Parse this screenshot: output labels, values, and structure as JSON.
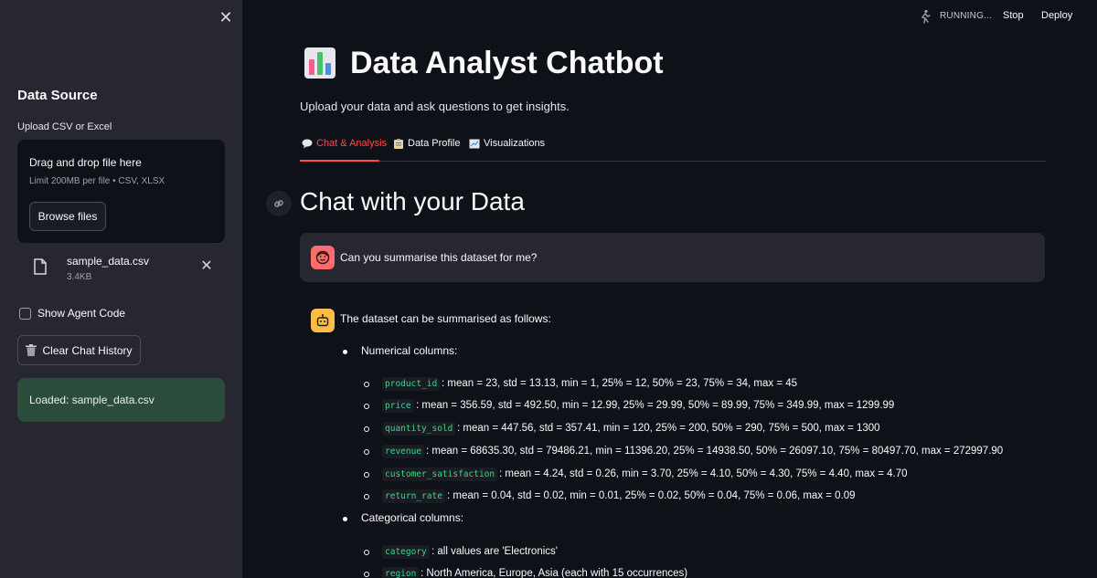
{
  "sidebar": {
    "title": "Data Source",
    "upload_label": "Upload CSV or Excel",
    "dropzone_title": "Drag and drop file here",
    "dropzone_limit": "Limit 200MB per file • CSV, XLSX",
    "browse_label": "Browse files",
    "file": {
      "name": "sample_data.csv",
      "size": "3.4KB"
    },
    "show_code_label": "Show Agent Code",
    "clear_label": "Clear Chat History",
    "loaded_text": "Loaded: sample_data.csv"
  },
  "topbar": {
    "status": "RUNNING...",
    "stop": "Stop",
    "deploy": "Deploy"
  },
  "main": {
    "title": "Data Analyst Chatbot",
    "subtitle": "Upload your data and ask questions to get insights.",
    "tabs": [
      {
        "label": "Chat & Analysis",
        "icon": "speech-bubble-icon"
      },
      {
        "label": "Data Profile",
        "icon": "clipboard-icon"
      },
      {
        "label": "Visualizations",
        "icon": "chart-icon"
      }
    ],
    "chat_title": "Chat with your Data"
  },
  "chat": {
    "user_message": "Can you summarise this dataset for me?",
    "bot_intro": "The dataset can be summarised as follows:",
    "numerical_heading": "Numerical columns:",
    "numerical": [
      {
        "col": "product_id",
        "stats": ": mean = 23, std = 13.13, min = 1, 25% = 12, 50% = 23, 75% = 34, max = 45"
      },
      {
        "col": "price",
        "stats": ": mean = 356.59, std = 492.50, min = 12.99, 25% = 29.99, 50% = 89.99, 75% = 349.99, max = 1299.99"
      },
      {
        "col": "quantity_sold",
        "stats": ": mean = 447.56, std = 357.41, min = 120, 25% = 200, 50% = 290, 75% = 500, max = 1300"
      },
      {
        "col": "revenue",
        "stats": ": mean = 68635.30, std = 79486.21, min = 11396.20, 25% = 14938.50, 50% = 26097.10, 75% = 80497.70, max = 272997.90"
      },
      {
        "col": "customer_satisfaction",
        "stats": ": mean = 4.24, std = 0.26, min = 3.70, 25% = 4.10, 50% = 4.30, 75% = 4.40, max = 4.70"
      },
      {
        "col": "return_rate",
        "stats": ": mean = 0.04, std = 0.02, min = 0.01, 25% = 0.02, 50% = 0.04, 75% = 0.06, max = 0.09"
      }
    ],
    "categorical_heading": "Categorical columns:",
    "categorical": [
      {
        "col": "category",
        "stats": ": all values are 'Electronics'"
      },
      {
        "col": "region",
        "stats": ": North America, Europe, Asia (each with 15 occurrences)"
      }
    ]
  },
  "colors": {
    "accent": "#ff4b4b",
    "success_bg": "#2b4c3a",
    "code": "#3ed58a"
  }
}
